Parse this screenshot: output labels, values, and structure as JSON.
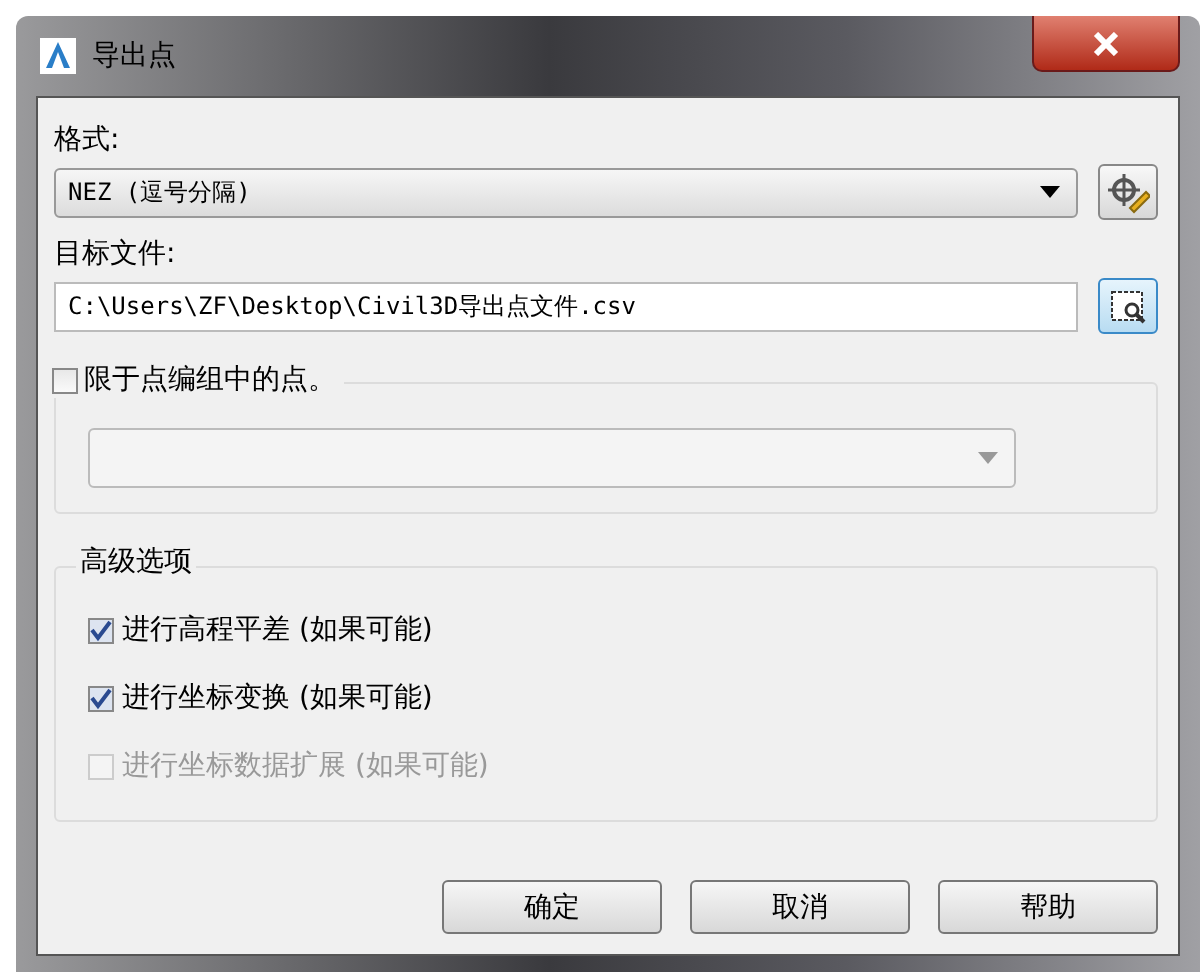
{
  "window": {
    "title": "导出点"
  },
  "format": {
    "label": "格式:",
    "value": "NEZ (逗号分隔)"
  },
  "target": {
    "label": "目标文件:",
    "value": "C:\\Users\\ZF\\Desktop\\Civil3D导出点文件.csv"
  },
  "group_filter": {
    "label": "限于点编组中的点。",
    "checked": false
  },
  "advanced": {
    "title": "高级选项",
    "options": [
      {
        "label": "进行高程平差 (如果可能)",
        "checked": true,
        "disabled": false
      },
      {
        "label": "进行坐标变换 (如果可能)",
        "checked": true,
        "disabled": false
      },
      {
        "label": "进行坐标数据扩展 (如果可能)",
        "checked": false,
        "disabled": true
      }
    ]
  },
  "buttons": [
    "确定",
    "取消",
    "帮助"
  ]
}
